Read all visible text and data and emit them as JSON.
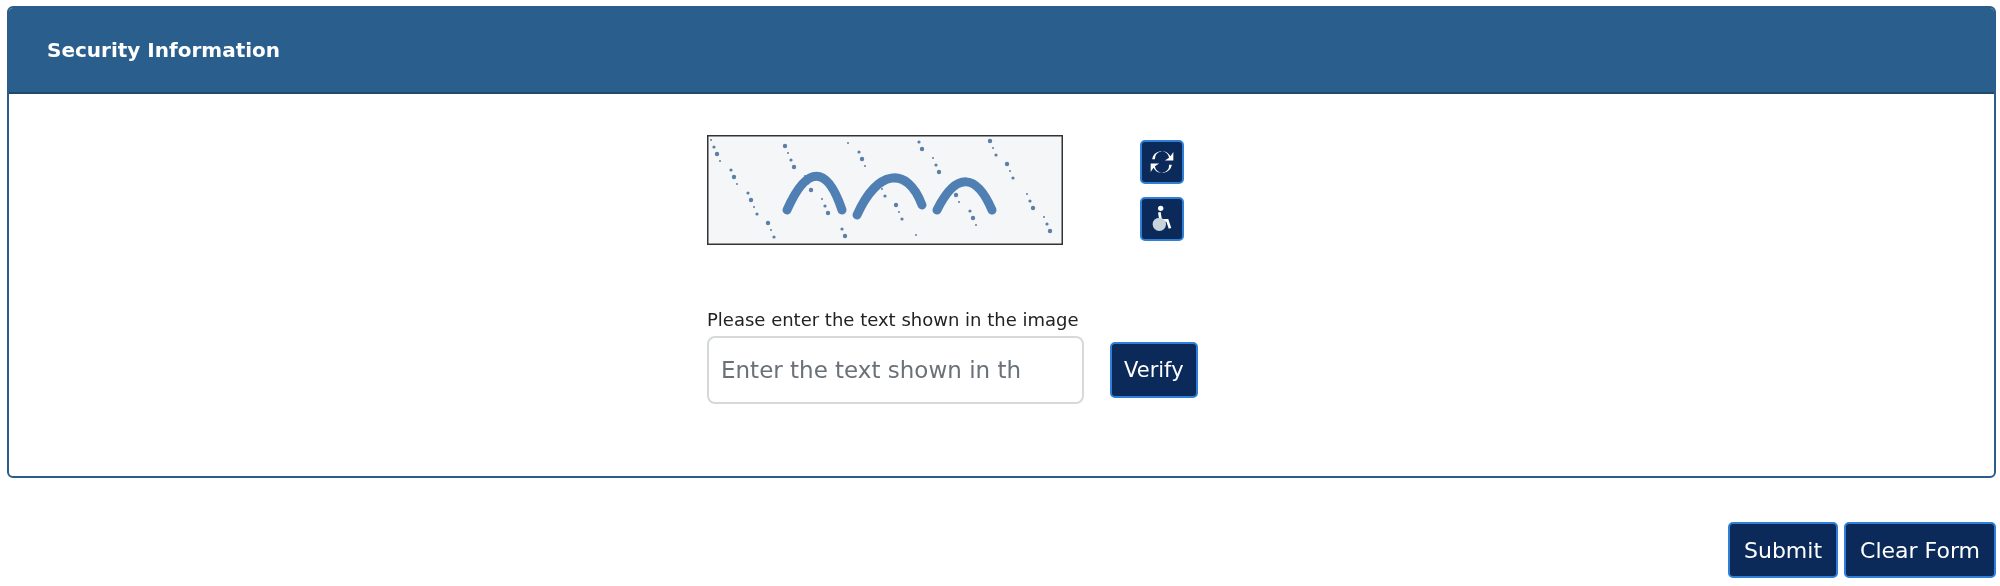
{
  "panel": {
    "title": "Security Information"
  },
  "captcha": {
    "label": "Please enter the text shown in the image",
    "placeholder": "Enter the text shown in th",
    "verify": "Verify"
  },
  "buttons": [
    "Submit",
    "Clear Form"
  ]
}
